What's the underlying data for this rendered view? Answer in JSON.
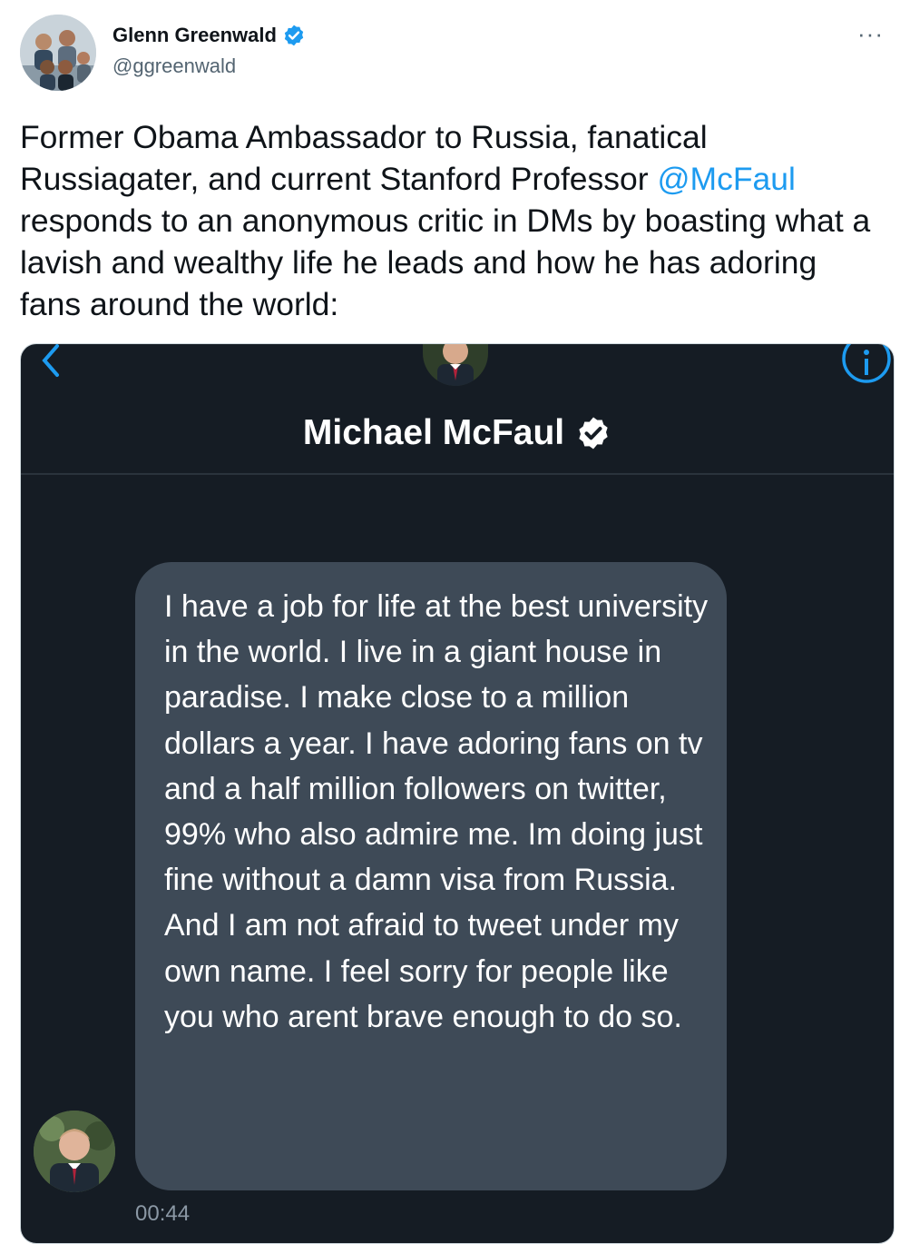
{
  "author": {
    "name": "Glenn Greenwald",
    "handle": "@ggreenwald",
    "verified": true,
    "more_icon": "more-horizontal-icon"
  },
  "tweet": {
    "text_before": "Former Obama Ambassador to Russia, fanatical Russiagater, and current Stanford Professor ",
    "mention": "@McFaul",
    "text_after": " responds to an anonymous critic in DMs by boasting what a lavish and wealthy life he leads and how he has adoring fans around the world:"
  },
  "dm_screenshot": {
    "title": "Michael McFaul",
    "verified": true,
    "back_icon": "chevron-left-icon",
    "info_icon": "info-icon",
    "message": "I have a job for life at the best university in the world. I live in a giant house in paradise. I make close to a million dollars a year. I have adoring fans on tv and a half million followers on twitter, 99% who also admire me.  Im doing just fine without a damn visa from Russia.  And I am not afraid to tweet under my own name.  I feel sorry for people like you who arent brave enough to do so.",
    "timestamp": "00:44"
  },
  "colors": {
    "link": "#1d9bf0",
    "dm_background": "#151c24",
    "bubble": "#3e4a57"
  }
}
